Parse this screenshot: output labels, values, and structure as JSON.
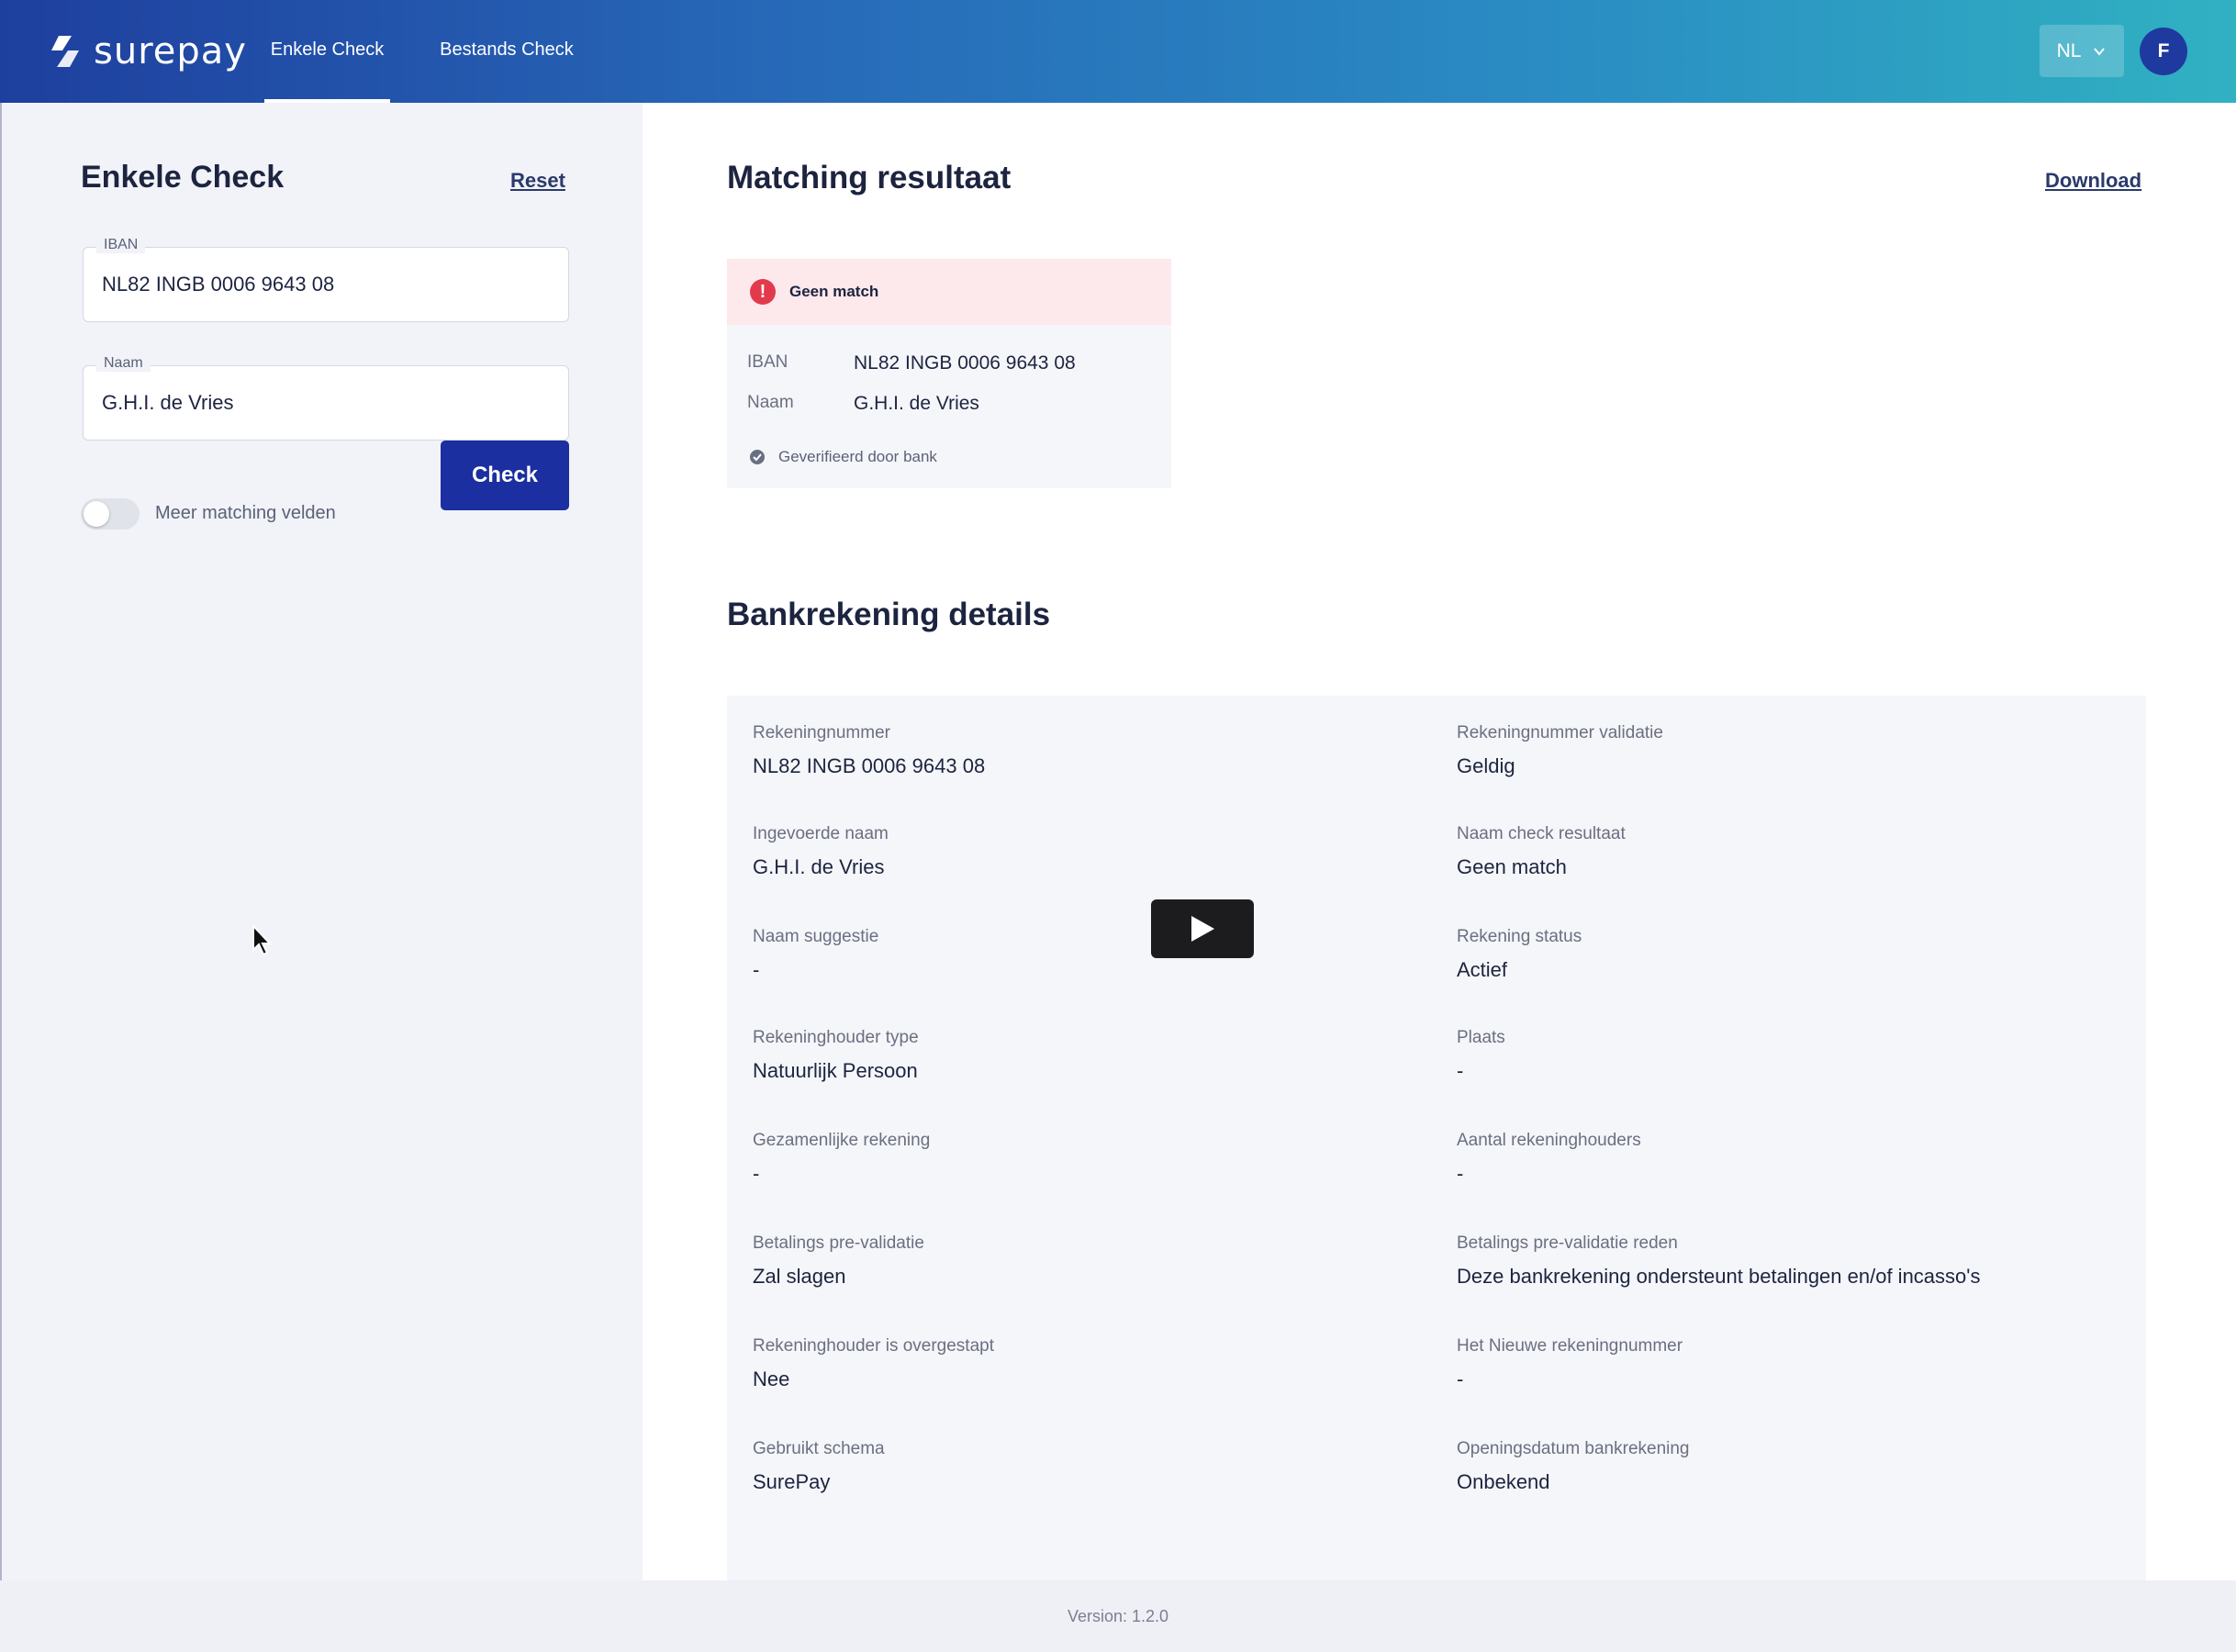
{
  "header": {
    "logo_text": "surepay",
    "tabs": [
      {
        "label": "Enkele Check",
        "active": true
      },
      {
        "label": "Bestands Check",
        "active": false
      }
    ],
    "language": "NL",
    "avatar_initial": "F",
    "icons": {
      "logo": "surepay-logo-icon",
      "language_chevron": "chevron-down-icon"
    }
  },
  "left": {
    "title": "Enkele Check",
    "reset_label": "Reset",
    "iban": {
      "label": "IBAN",
      "value": "NL82 INGB 0006 9643 08"
    },
    "naam": {
      "label": "Naam",
      "value": "G.H.I. de Vries"
    },
    "toggle": {
      "label": "Meer matching velden",
      "on": false
    },
    "check_label": "Check"
  },
  "matching": {
    "title": "Matching resultaat",
    "download_label": "Download",
    "status": "Geen match",
    "status_color": "#e23a4c",
    "rows": [
      {
        "label": "IBAN",
        "value": "NL82 INGB 0006 9643 08"
      },
      {
        "label": "Naam",
        "value": "G.H.I. de Vries"
      }
    ],
    "verified_text": "Geverifieerd door bank"
  },
  "details": {
    "title": "Bankrekening details",
    "items": [
      {
        "label": "Rekeningnummer",
        "value": "NL82 INGB 0006 9643 08"
      },
      {
        "label": "Rekeningnummer validatie",
        "value": "Geldig"
      },
      {
        "label": "Ingevoerde naam",
        "value": "G.H.I. de Vries"
      },
      {
        "label": "Naam check resultaat",
        "value": "Geen match"
      },
      {
        "label": "Naam suggestie",
        "value": "-"
      },
      {
        "label": "Rekening status",
        "value": "Actief"
      },
      {
        "label": "Rekeninghouder type",
        "value": "Natuurlijk Persoon"
      },
      {
        "label": "Plaats",
        "value": "-"
      },
      {
        "label": "Gezamenlijke rekening",
        "value": "-"
      },
      {
        "label": "Aantal rekeninghouders",
        "value": "-"
      },
      {
        "label": "Betalings pre-validatie",
        "value": "Zal slagen"
      },
      {
        "label": "Betalings pre-validatie reden",
        "value": "Deze bankrekening ondersteunt betalingen en/of incasso's"
      },
      {
        "label": "Rekeninghouder is overgestapt",
        "value": "Nee"
      },
      {
        "label": "Het Nieuwe rekeningnummer",
        "value": "-"
      },
      {
        "label": "Gebruikt schema",
        "value": "SurePay"
      },
      {
        "label": "Openingsdatum bankrekening",
        "value": "Onbekend"
      }
    ]
  },
  "footer": {
    "version": "Version: 1.2.0"
  },
  "colors": {
    "primary": "#1b2fa0",
    "header_gradient_start": "#1e3f9e",
    "header_gradient_end": "#30b1c2"
  }
}
